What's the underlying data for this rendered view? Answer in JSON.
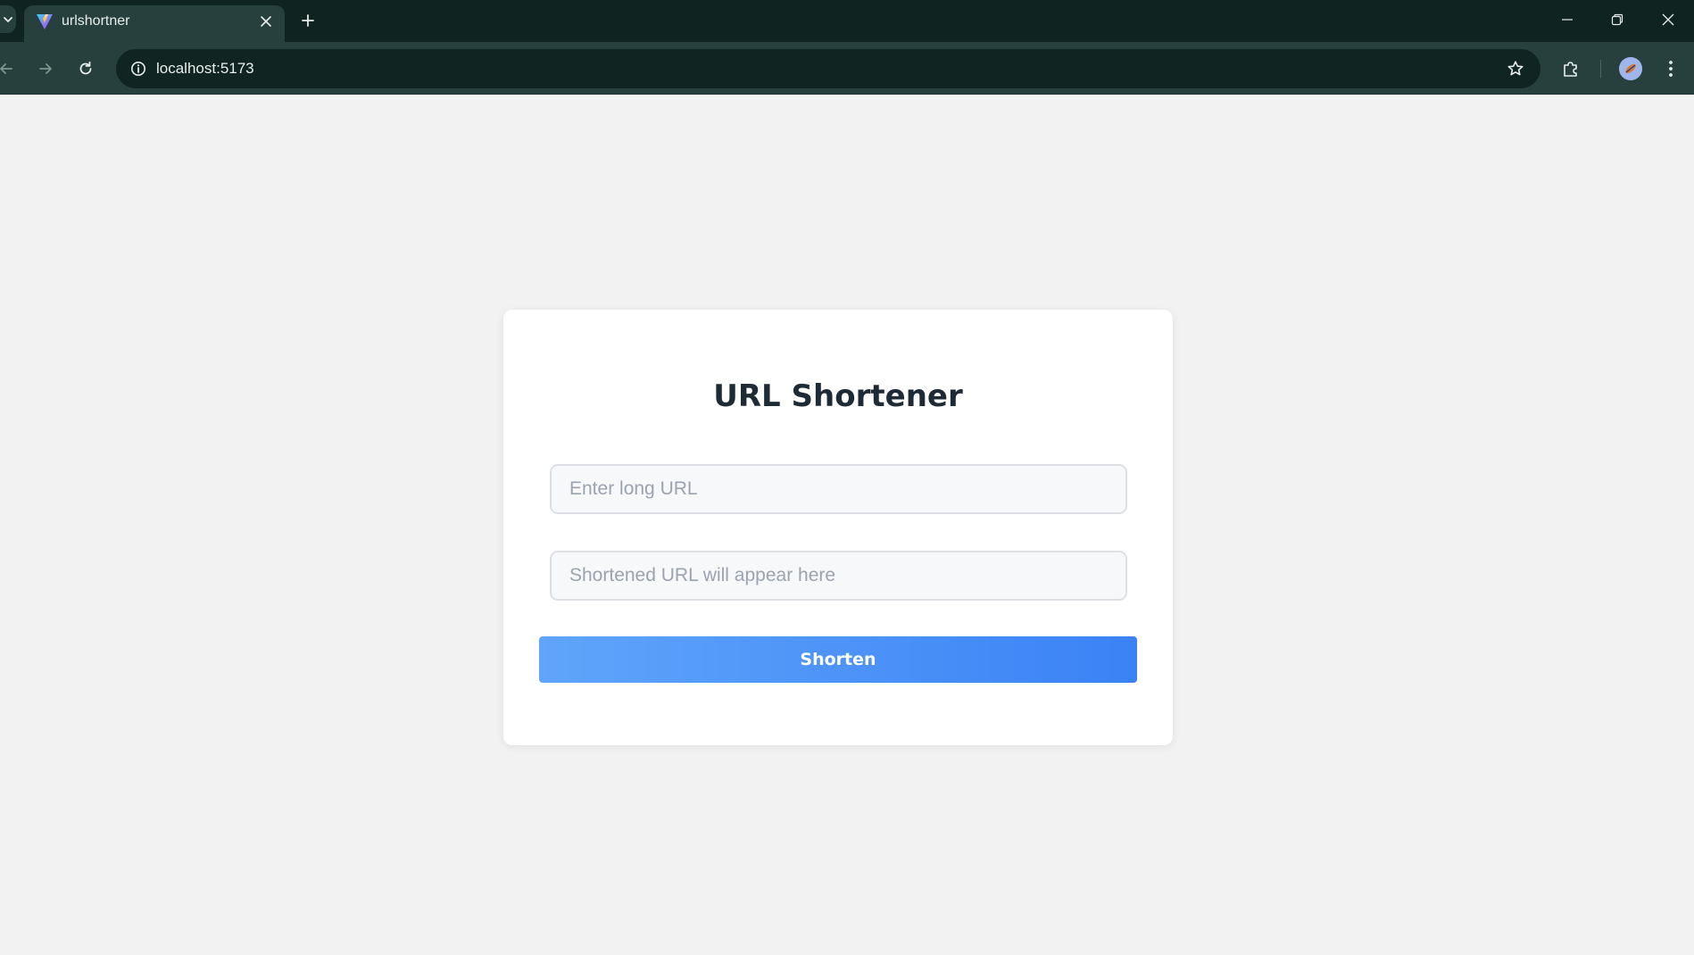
{
  "browser": {
    "tab": {
      "title": "urlshortner"
    },
    "address_bar": {
      "url": "localhost:5173"
    },
    "icons": {
      "tab_list": "chevron-down-icon",
      "favicon": "vite-logo-icon",
      "tab_close": "close-icon",
      "new_tab": "plus-icon",
      "minimize": "minimize-icon",
      "restore": "restore-icon",
      "window_close": "close-icon",
      "back": "arrow-left-icon",
      "forward": "arrow-right-icon",
      "reload": "reload-icon",
      "site_info": "info-icon",
      "bookmark": "star-icon",
      "extensions": "puzzle-icon",
      "profile": "avatar-icon",
      "menu": "more-vertical-icon"
    }
  },
  "page": {
    "title": "URL Shortener",
    "long_url_input": {
      "value": "",
      "placeholder": "Enter long URL"
    },
    "short_url_output": {
      "value": "",
      "placeholder": "Shortened URL will appear here"
    },
    "shorten_button": {
      "label": "Shorten"
    }
  },
  "colors": {
    "chrome_background": "#0f2321",
    "toolbar_background": "#27403d",
    "page_background": "#f2f2f2",
    "card_background": "#ffffff",
    "title_text": "#1f2a37",
    "button_gradient_start": "#60a5fa",
    "button_gradient_end": "#3b82f6"
  }
}
